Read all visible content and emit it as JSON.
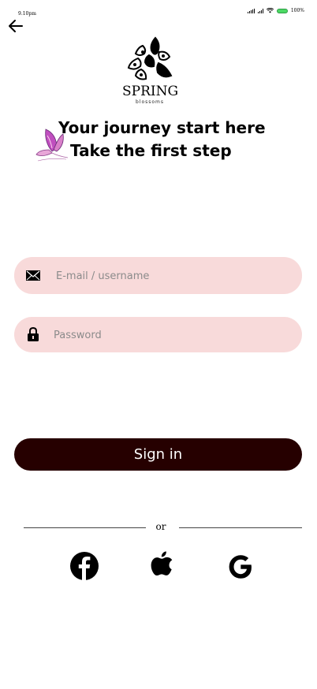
{
  "status_bar": {
    "time": "9.10pm",
    "battery": "100%"
  },
  "icons": {
    "back": "arrow-left-icon",
    "email": "envelope-icon",
    "password": "lock-icon",
    "facebook": "facebook-icon",
    "apple": "apple-icon",
    "google": "google-icon",
    "butterfly": "butterfly-icon"
  },
  "logo": {
    "name": "SPRING",
    "subtitle": "blossoms"
  },
  "headline": {
    "line1": "Your journey start here",
    "line2": "Take the first step"
  },
  "form": {
    "email_placeholder": "E-mail / username",
    "email_value": "",
    "password_placeholder": "Password",
    "password_value": "",
    "signin_label": "Sign in"
  },
  "divider": {
    "text": "or"
  },
  "colors": {
    "input_bg": "#f8dada",
    "button_bg": "#260000",
    "button_text": "#ffffff",
    "butterfly": "#c04fbf",
    "battery": "#4cd964"
  }
}
